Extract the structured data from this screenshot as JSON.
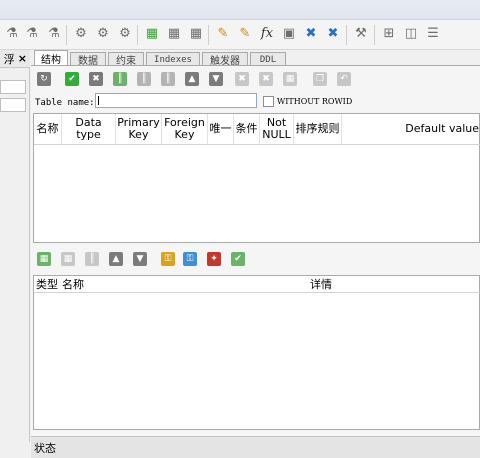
{
  "left_panel": {
    "tab_label": "浮",
    "close_label": "×"
  },
  "toolbar": {
    "icons": [
      "link-icon",
      "link-icon",
      "link-icon",
      "gear-icon",
      "gear-icon",
      "gear-icon",
      "table-add-icon",
      "table-icon",
      "table-icon",
      "edit-icon",
      "edit-icon",
      "function-icon",
      "id-card-icon",
      "expand-icon",
      "expand-icon",
      "wrench-icon",
      "grid-icon",
      "grid-icon",
      "grid-icon"
    ],
    "fx_label": "fx"
  },
  "tabs": [
    {
      "label": "结构",
      "active": true
    },
    {
      "label": "数据",
      "active": false
    },
    {
      "label": "约束",
      "active": false
    },
    {
      "label": "Indexes",
      "active": false
    },
    {
      "label": "触发器",
      "active": false
    },
    {
      "label": "DDL",
      "active": false
    }
  ],
  "structure": {
    "table_name_label": "Table name:",
    "table_name_value": "",
    "without_rowid_label": "WITHOUT ROWID",
    "columns": [
      "名称",
      "Data type",
      "Primary Key",
      "Foreign Key",
      "唯一",
      "条件",
      "Not NULL",
      "排序规则",
      "Default value"
    ]
  },
  "constraints": {
    "columns": [
      "类型",
      "名称",
      "详情"
    ]
  },
  "status_label": "状态",
  "colors": {
    "green": "#2fae3a",
    "blue_border": "#8fa7c9"
  }
}
